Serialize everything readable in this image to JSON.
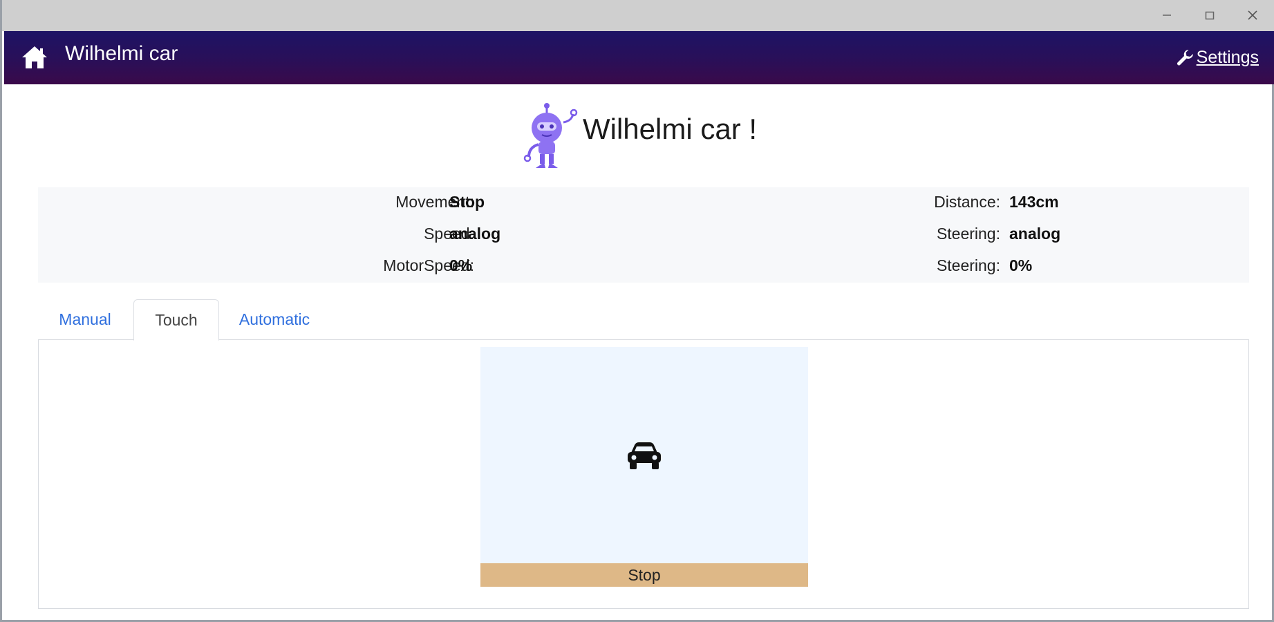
{
  "window": {
    "controls": [
      "minimize-icon",
      "maximize-icon",
      "close-icon"
    ]
  },
  "navbar": {
    "brand": "Wilhelmi car",
    "settings_label": "Settings",
    "gradient_top": "#1d1465",
    "gradient_bottom": "#3a0a4a"
  },
  "hero": {
    "title": "Wilhelmi car !",
    "logo": "robot-logo-icon",
    "logo_color": "#8b6cf0"
  },
  "status": {
    "movement": {
      "label": "Movement:",
      "value": "Stop"
    },
    "speed": {
      "label": "Speed:",
      "value": "analog"
    },
    "motor_speed": {
      "label": "MotorSpeed:",
      "value": "0%"
    },
    "distance": {
      "label": "Distance:",
      "value": "143cm"
    },
    "steering_mode": {
      "label": "Steering:",
      "value": "analog"
    },
    "steering_value": {
      "label": "Steering:",
      "value": "0%"
    }
  },
  "tabs": [
    {
      "label": "Manual",
      "active": false
    },
    {
      "label": "Touch",
      "active": true
    },
    {
      "label": "Automatic",
      "active": false
    }
  ],
  "touch": {
    "icon": "car-icon",
    "stop_label": "Stop",
    "pad_color": "#eef6ff",
    "stop_color": "#deb887"
  }
}
